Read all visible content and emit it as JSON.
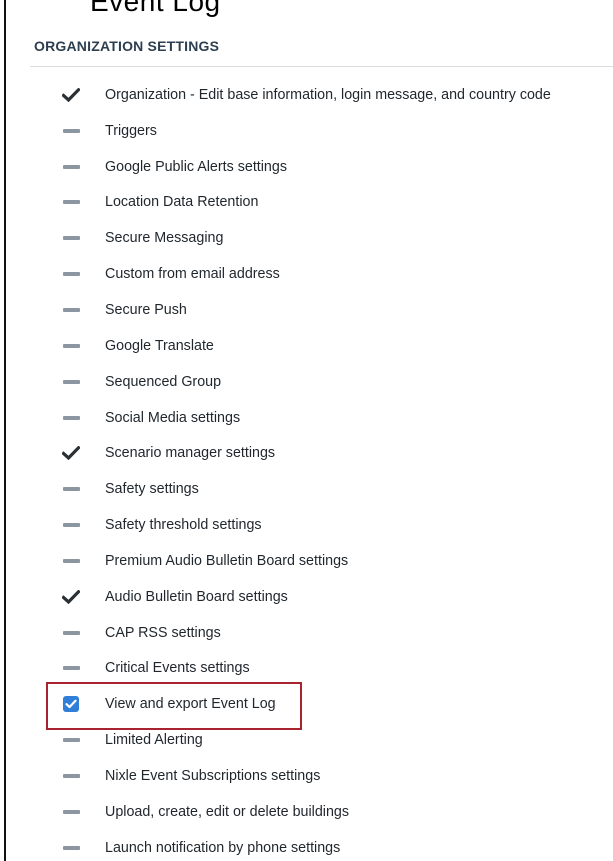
{
  "header": {
    "cut_text": "Event Log",
    "section_title": "ORGANIZATION SETTINGS"
  },
  "settings": [
    {
      "label": "Organization - Edit base information, login message, and country code",
      "state": "check"
    },
    {
      "label": "Triggers",
      "state": "dash"
    },
    {
      "label": "Google Public Alerts settings",
      "state": "dash"
    },
    {
      "label": "Location Data Retention",
      "state": "dash"
    },
    {
      "label": "Secure Messaging",
      "state": "dash"
    },
    {
      "label": "Custom from email address",
      "state": "dash"
    },
    {
      "label": "Secure Push",
      "state": "dash"
    },
    {
      "label": "Google Translate",
      "state": "dash"
    },
    {
      "label": "Sequenced Group",
      "state": "dash"
    },
    {
      "label": "Social Media settings",
      "state": "dash"
    },
    {
      "label": "Scenario manager settings",
      "state": "check"
    },
    {
      "label": "Safety settings",
      "state": "dash"
    },
    {
      "label": "Safety threshold settings",
      "state": "dash"
    },
    {
      "label": "Premium Audio Bulletin Board settings",
      "state": "dash"
    },
    {
      "label": "Audio Bulletin Board settings",
      "state": "check"
    },
    {
      "label": "CAP RSS settings",
      "state": "dash"
    },
    {
      "label": "Critical Events settings",
      "state": "dash"
    },
    {
      "label": "View and export Event Log",
      "state": "checkbox-checked"
    },
    {
      "label": "Limited Alerting",
      "state": "dash"
    },
    {
      "label": "Nixle Event Subscriptions settings",
      "state": "dash"
    },
    {
      "label": "Upload, create, edit or delete buildings",
      "state": "dash"
    },
    {
      "label": "Launch notification by phone settings",
      "state": "dash"
    }
  ],
  "colors": {
    "check": "#2b3035",
    "dash": "#8c96a0",
    "checkbox": "#2f7fd8",
    "highlight": "#a8222f"
  }
}
